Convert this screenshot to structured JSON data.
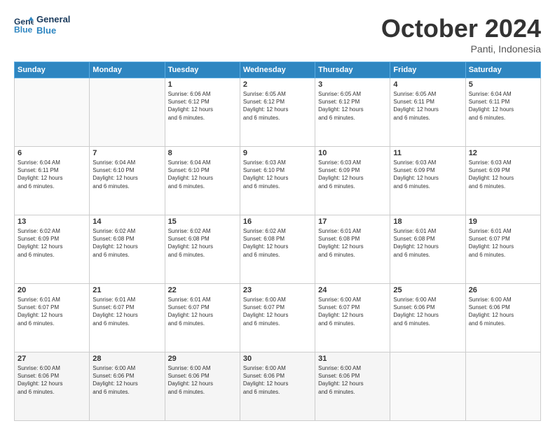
{
  "header": {
    "logo_line1": "General",
    "logo_line2": "Blue",
    "month_year": "October 2024",
    "location": "Panti, Indonesia"
  },
  "days_of_week": [
    "Sunday",
    "Monday",
    "Tuesday",
    "Wednesday",
    "Thursday",
    "Friday",
    "Saturday"
  ],
  "weeks": [
    [
      {
        "day": "",
        "content": ""
      },
      {
        "day": "",
        "content": ""
      },
      {
        "day": "1",
        "content": "Sunrise: 6:06 AM\nSunset: 6:12 PM\nDaylight: 12 hours\nand 6 minutes."
      },
      {
        "day": "2",
        "content": "Sunrise: 6:05 AM\nSunset: 6:12 PM\nDaylight: 12 hours\nand 6 minutes."
      },
      {
        "day": "3",
        "content": "Sunrise: 6:05 AM\nSunset: 6:12 PM\nDaylight: 12 hours\nand 6 minutes."
      },
      {
        "day": "4",
        "content": "Sunrise: 6:05 AM\nSunset: 6:11 PM\nDaylight: 12 hours\nand 6 minutes."
      },
      {
        "day": "5",
        "content": "Sunrise: 6:04 AM\nSunset: 6:11 PM\nDaylight: 12 hours\nand 6 minutes."
      }
    ],
    [
      {
        "day": "6",
        "content": "Sunrise: 6:04 AM\nSunset: 6:11 PM\nDaylight: 12 hours\nand 6 minutes."
      },
      {
        "day": "7",
        "content": "Sunrise: 6:04 AM\nSunset: 6:10 PM\nDaylight: 12 hours\nand 6 minutes."
      },
      {
        "day": "8",
        "content": "Sunrise: 6:04 AM\nSunset: 6:10 PM\nDaylight: 12 hours\nand 6 minutes."
      },
      {
        "day": "9",
        "content": "Sunrise: 6:03 AM\nSunset: 6:10 PM\nDaylight: 12 hours\nand 6 minutes."
      },
      {
        "day": "10",
        "content": "Sunrise: 6:03 AM\nSunset: 6:09 PM\nDaylight: 12 hours\nand 6 minutes."
      },
      {
        "day": "11",
        "content": "Sunrise: 6:03 AM\nSunset: 6:09 PM\nDaylight: 12 hours\nand 6 minutes."
      },
      {
        "day": "12",
        "content": "Sunrise: 6:03 AM\nSunset: 6:09 PM\nDaylight: 12 hours\nand 6 minutes."
      }
    ],
    [
      {
        "day": "13",
        "content": "Sunrise: 6:02 AM\nSunset: 6:09 PM\nDaylight: 12 hours\nand 6 minutes."
      },
      {
        "day": "14",
        "content": "Sunrise: 6:02 AM\nSunset: 6:08 PM\nDaylight: 12 hours\nand 6 minutes."
      },
      {
        "day": "15",
        "content": "Sunrise: 6:02 AM\nSunset: 6:08 PM\nDaylight: 12 hours\nand 6 minutes."
      },
      {
        "day": "16",
        "content": "Sunrise: 6:02 AM\nSunset: 6:08 PM\nDaylight: 12 hours\nand 6 minutes."
      },
      {
        "day": "17",
        "content": "Sunrise: 6:01 AM\nSunset: 6:08 PM\nDaylight: 12 hours\nand 6 minutes."
      },
      {
        "day": "18",
        "content": "Sunrise: 6:01 AM\nSunset: 6:08 PM\nDaylight: 12 hours\nand 6 minutes."
      },
      {
        "day": "19",
        "content": "Sunrise: 6:01 AM\nSunset: 6:07 PM\nDaylight: 12 hours\nand 6 minutes."
      }
    ],
    [
      {
        "day": "20",
        "content": "Sunrise: 6:01 AM\nSunset: 6:07 PM\nDaylight: 12 hours\nand 6 minutes."
      },
      {
        "day": "21",
        "content": "Sunrise: 6:01 AM\nSunset: 6:07 PM\nDaylight: 12 hours\nand 6 minutes."
      },
      {
        "day": "22",
        "content": "Sunrise: 6:01 AM\nSunset: 6:07 PM\nDaylight: 12 hours\nand 6 minutes."
      },
      {
        "day": "23",
        "content": "Sunrise: 6:00 AM\nSunset: 6:07 PM\nDaylight: 12 hours\nand 6 minutes."
      },
      {
        "day": "24",
        "content": "Sunrise: 6:00 AM\nSunset: 6:07 PM\nDaylight: 12 hours\nand 6 minutes."
      },
      {
        "day": "25",
        "content": "Sunrise: 6:00 AM\nSunset: 6:06 PM\nDaylight: 12 hours\nand 6 minutes."
      },
      {
        "day": "26",
        "content": "Sunrise: 6:00 AM\nSunset: 6:06 PM\nDaylight: 12 hours\nand 6 minutes."
      }
    ],
    [
      {
        "day": "27",
        "content": "Sunrise: 6:00 AM\nSunset: 6:06 PM\nDaylight: 12 hours\nand 6 minutes."
      },
      {
        "day": "28",
        "content": "Sunrise: 6:00 AM\nSunset: 6:06 PM\nDaylight: 12 hours\nand 6 minutes."
      },
      {
        "day": "29",
        "content": "Sunrise: 6:00 AM\nSunset: 6:06 PM\nDaylight: 12 hours\nand 6 minutes."
      },
      {
        "day": "30",
        "content": "Sunrise: 6:00 AM\nSunset: 6:06 PM\nDaylight: 12 hours\nand 6 minutes."
      },
      {
        "day": "31",
        "content": "Sunrise: 6:00 AM\nSunset: 6:06 PM\nDaylight: 12 hours\nand 6 minutes."
      },
      {
        "day": "",
        "content": ""
      },
      {
        "day": "",
        "content": ""
      }
    ]
  ]
}
